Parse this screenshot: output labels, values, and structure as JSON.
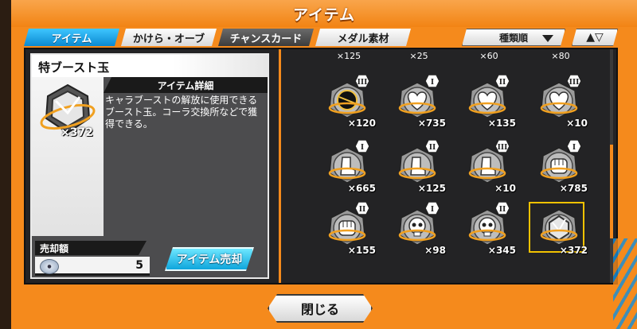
{
  "window": {
    "title": "アイテム"
  },
  "tabs": [
    {
      "label": "アイテム"
    },
    {
      "label": "かけら・オーブ"
    },
    {
      "label": "チャンスカード"
    },
    {
      "label": "メダル素材"
    }
  ],
  "sort": {
    "label": "種類順",
    "order_icons": "▲▽"
  },
  "detail": {
    "item_name": "特ブースト玉",
    "item_count": "×372",
    "header": "アイテム詳細",
    "description": "キャラブーストの解放に使用できるブースト玉。コーラ交換所などで獲得できる。",
    "sell_label": "売却額",
    "sell_value": "5",
    "sell_button": "アイテム売却"
  },
  "grid": {
    "top_counts": [
      "×125",
      "×25",
      "×60",
      "×80"
    ],
    "rows": [
      [
        {
          "icon": "black-orb-icon",
          "rank": "III",
          "count": "×120",
          "color": "#222"
        },
        {
          "icon": "heart-icon",
          "rank": "I",
          "count": "×735",
          "color": "#eee"
        },
        {
          "icon": "heart-icon",
          "rank": "II",
          "count": "×135",
          "color": "#eee"
        },
        {
          "icon": "heart-icon",
          "rank": "III",
          "count": "×10",
          "color": "#eee"
        }
      ],
      [
        {
          "icon": "boot-icon",
          "rank": "I",
          "count": "×665",
          "color": "#eee"
        },
        {
          "icon": "boot-icon",
          "rank": "II",
          "count": "×125",
          "color": "#eee"
        },
        {
          "icon": "boot-icon",
          "rank": "III",
          "count": "×10",
          "color": "#eee"
        },
        {
          "icon": "fist-icon",
          "rank": "I",
          "count": "×785",
          "color": "#eee"
        }
      ],
      [
        {
          "icon": "fist-icon",
          "rank": "II",
          "count": "×155",
          "color": "#eee"
        },
        {
          "icon": "skull-icon",
          "rank": "I",
          "count": "×98",
          "color": "#eee"
        },
        {
          "icon": "skull-icon",
          "rank": "II",
          "count": "×345",
          "color": "#eee"
        },
        {
          "icon": "boost-orb-icon",
          "rank": "",
          "count": "×372",
          "color": "#ccc"
        }
      ]
    ]
  },
  "footer": {
    "close_label": "閉じる"
  },
  "colors": {
    "accent": "#f58a1c",
    "tab_active": "#0b89d0",
    "selected": "#f2c200"
  }
}
